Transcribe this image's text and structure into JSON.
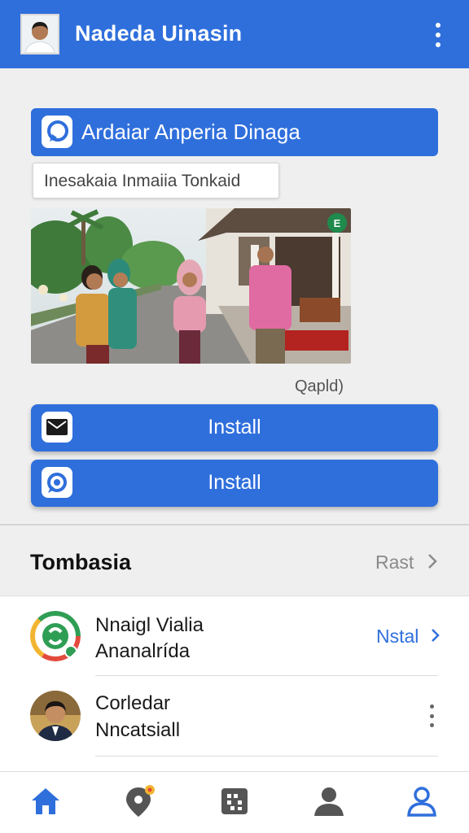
{
  "appbar": {
    "title": "Nadeda Uinasin",
    "more_icon": "more-vert-icon",
    "color": "#2f6fdc"
  },
  "banner": {
    "icon": "chat-bubble-icon",
    "text": "Ardaiar Anperia Dinaga"
  },
  "chip": {
    "text": "Inesakaia Inmaiia Tonkaid"
  },
  "photo": {
    "badge": "E",
    "caption": "Qapld)"
  },
  "install_buttons": [
    {
      "icon": "mail-icon",
      "label": "Install"
    },
    {
      "icon": "sync-icon",
      "label": "Install"
    }
  ],
  "section": {
    "title": "Tombasia",
    "link": "Rast"
  },
  "list": [
    {
      "line1": "Nnaigl Vialia",
      "line2": "Ananalrída",
      "action": "Nstal",
      "icon": "app-logo-icon"
    },
    {
      "line1": "Corledar",
      "line2": "Nncatsiall",
      "action_icon": "more-vert-icon"
    }
  ],
  "bottom_nav": [
    {
      "name": "home",
      "icon": "home-icon",
      "active": true
    },
    {
      "name": "places",
      "icon": "location-icon",
      "active": false
    },
    {
      "name": "apps",
      "icon": "grid-icon",
      "active": false
    },
    {
      "name": "people",
      "icon": "person-icon",
      "active": false
    },
    {
      "name": "profile",
      "icon": "account-icon",
      "active": true
    }
  ]
}
